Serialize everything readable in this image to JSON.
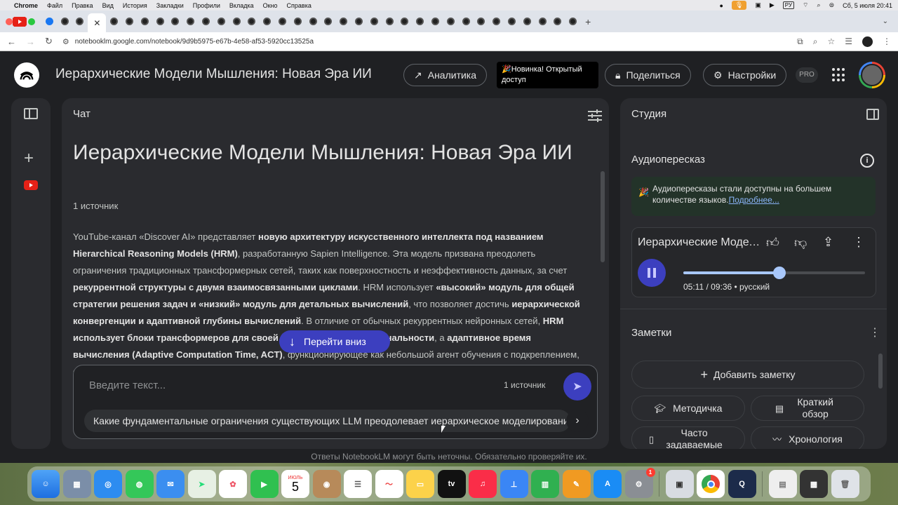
{
  "menubar": {
    "app": "Chrome",
    "items": [
      "Файл",
      "Правка",
      "Вид",
      "История",
      "Закладки",
      "Профили",
      "Вкладка",
      "Окно",
      "Справка"
    ],
    "keyboard": "РУ",
    "datetime": "Сб, 5 июля  20:41"
  },
  "browser": {
    "url": "notebooklm.google.com/notebook/9d9b5975-e67b-4e58-af53-5920cc13525a"
  },
  "header": {
    "title": "Иерархические Модели Мышления: Новая Эра ИИ",
    "analytics": "Аналитика",
    "new_badge": "🎉Новинка! Открытый доступ",
    "share": "Поделиться",
    "settings": "Настройки",
    "pro": "PRO"
  },
  "chat": {
    "heading": "Чат",
    "doc_title": "Иерархические Модели Мышления: Новая Эра ИИ",
    "source_count": "1 источник",
    "summary": [
      {
        "t": "YouTube-канал «Discover AI» представляет ",
        "b": false
      },
      {
        "t": "новую архитектуру искусственного интеллекта под названием Hierarchical Reasoning Models (HRM)",
        "b": true
      },
      {
        "t": ", разработанную Sapien Intelligence. Эта модель призвана преодолеть ограничения традиционных трансформерных сетей, таких как поверхностность и неэффективность данных, за счет ",
        "b": false
      },
      {
        "t": "рекуррентной структуры с двумя взаимосвязанными циклами",
        "b": true
      },
      {
        "t": ". HRM использует ",
        "b": false
      },
      {
        "t": "«высокий» модуль для общей стратегии решения задач и «низкий» модуль для детальных вычислений",
        "b": true
      },
      {
        "t": ", что позволяет достичь ",
        "b": false
      },
      {
        "t": "иерархической конвергенции и адаптивной глубины вычислений",
        "b": true
      },
      {
        "t": ". В отличие от обычных рекуррентных нейронных сетей, ",
        "b": false
      },
      {
        "t": "HRM использует блоки трансформеров для своей рекуррентной функциональности",
        "b": true
      },
      {
        "t": ", а ",
        "b": false
      },
      {
        "t": "адаптивное время вычисления (Adaptive Computation Time, ACT)",
        "b": true
      },
      {
        "t": ", функционирующее как небольшой агент обучения с подкреплением, определяет",
        "b": false
      }
    ],
    "jump_down": "Перейти вниз",
    "input_placeholder": "Введите текст...",
    "input_sources": "1 источник",
    "suggestion": "Какие фундаментальные ограничения существующих LLM преодолевает иерархическое моделирование?",
    "disclaimer": "Ответы NotebookLM могут быть неточны. Обязательно проверяйте их."
  },
  "studio": {
    "heading": "Студия",
    "audio_title": "Аудиопересказ",
    "notice_text": "Аудиопересказы стали доступны на большем количестве языков.",
    "notice_link": "Подробнее...",
    "player_title": "Иерархические Модели Мышления: Новая Эра ИИ",
    "progress": 0.5296,
    "player_time": "05:11 / 09:36 • русский",
    "notes_title": "Заметки",
    "add_note": "Добавить заметку",
    "note_buttons": [
      "Методичка",
      "Краткий обзор",
      "Часто задаваемые",
      "Хронология"
    ]
  },
  "dock": {
    "calendar_month": "ИЮЛЬ",
    "calendar_day": "5",
    "appletv": "tv",
    "settings_badge": "1"
  }
}
